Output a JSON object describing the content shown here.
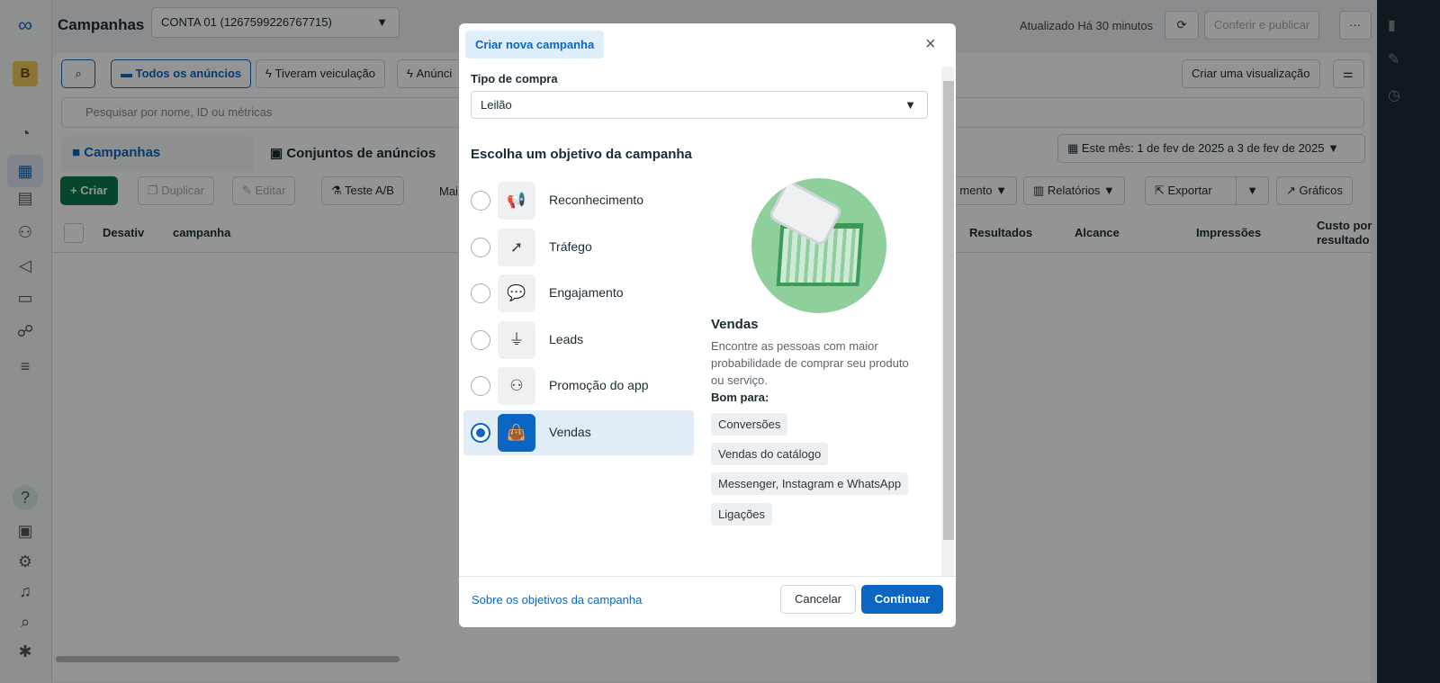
{
  "app": {
    "title": "Campanhas",
    "account": "CONTA 01 (1267599226767715)",
    "updated": "Atualizado Há 30 minutos",
    "publish": "Conferir e publicar",
    "more": "···",
    "avatar": "B"
  },
  "filters": {
    "all_ads": "Todos os anúncios",
    "delivered": "Tiveram veiculação",
    "ads": "Anúnci",
    "create_view": "Criar uma visualização",
    "search_placeholder": "Pesquisar por nome, ID ou métricas"
  },
  "tabs": {
    "campaigns": "Campanhas",
    "adsets": "Conjuntos de anúncios"
  },
  "date_range": "Este mês: 1 de fev de 2025 a 3 de fev de 2025",
  "toolbar": {
    "create": "Criar",
    "duplicate": "Duplicar",
    "edit": "Editar",
    "ab_test": "Teste A/B",
    "more": "Mai",
    "breakdown": "mento",
    "reports": "Relatórios",
    "export": "Exportar",
    "charts": "Gráficos"
  },
  "table": {
    "columns": [
      "Desativ",
      "campanha",
      "Resultados",
      "Alcance",
      "Impressões",
      "Custo por resultado"
    ]
  },
  "modal": {
    "title": "Criar nova campanha",
    "buy_type_label": "Tipo de compra",
    "buy_type_value": "Leilão",
    "objective_heading": "Escolha um objetivo da campanha",
    "objectives": [
      {
        "label": "Reconhecimento",
        "icon": "megaphone-icon",
        "selected": false
      },
      {
        "label": "Tráfego",
        "icon": "cursor-icon",
        "selected": false
      },
      {
        "label": "Engajamento",
        "icon": "chat-icon",
        "selected": false
      },
      {
        "label": "Leads",
        "icon": "funnel-icon",
        "selected": false
      },
      {
        "label": "Promoção do app",
        "icon": "people-icon",
        "selected": false
      },
      {
        "label": "Vendas",
        "icon": "shopping-bag-icon",
        "selected": true
      }
    ],
    "detail": {
      "title": "Vendas",
      "description": "Encontre as pessoas com maior probabilidade de comprar seu produto ou serviço.",
      "good_for": "Bom para:",
      "chips": [
        "Conversões",
        "Vendas do catálogo",
        "Messenger, Instagram e WhatsApp",
        "Ligações"
      ]
    },
    "footer": {
      "link": "Sobre os objetivos da campanha",
      "cancel": "Cancelar",
      "continue": "Continuar"
    }
  },
  "colors": {
    "primary": "#0a66c2",
    "create_green": "#0a7b4a",
    "illustration_green": "#8fcf9c"
  }
}
